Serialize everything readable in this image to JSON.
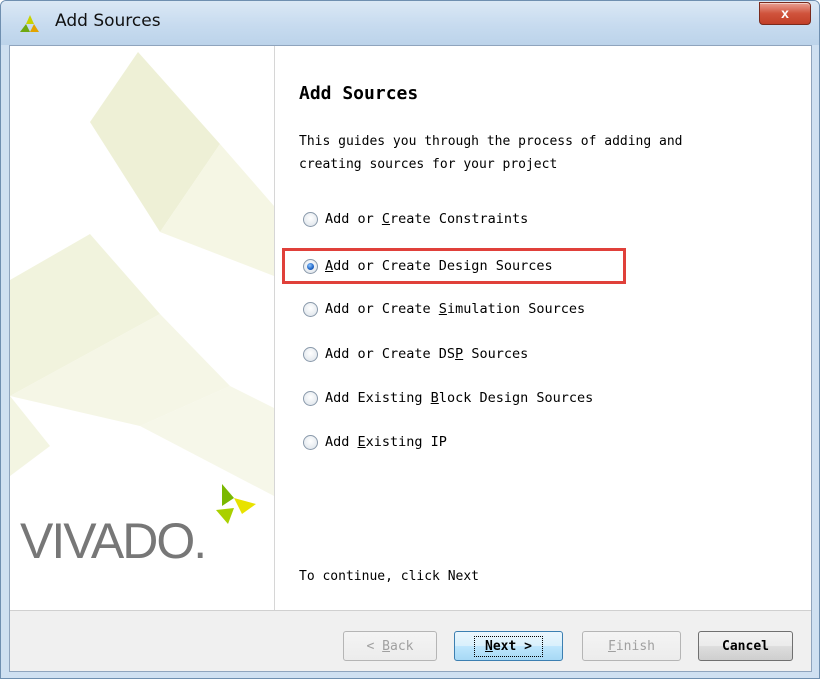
{
  "window": {
    "title": "Add Sources",
    "close_label": "x"
  },
  "logo": {
    "text": "VIVADO",
    "dot": "."
  },
  "main": {
    "heading": "Add Sources",
    "description_line1": "This guides you through the process of adding and",
    "description_line2": "creating sources for your project",
    "options": [
      {
        "pre": "Add or ",
        "mn": "C",
        "post": "reate Constraints",
        "checked": false
      },
      {
        "pre": "",
        "mn": "A",
        "post": "dd or Create Design Sources",
        "checked": true
      },
      {
        "pre": "Add or Create ",
        "mn": "S",
        "post": "imulation Sources",
        "checked": false
      },
      {
        "pre": "Add or Create DS",
        "mn": "P",
        "post": " Sources",
        "checked": false
      },
      {
        "pre": "Add Existing ",
        "mn": "B",
        "post": "lock Design Sources",
        "checked": false
      },
      {
        "pre": "Add ",
        "mn": "E",
        "post": "xisting IP",
        "checked": false
      }
    ],
    "footer": "To continue, click Next"
  },
  "buttons": {
    "back": {
      "pre": "< ",
      "mn": "B",
      "post": "ack"
    },
    "next": {
      "pre": "",
      "mn": "N",
      "post": "ext >"
    },
    "finish": {
      "pre": "",
      "mn": "F",
      "post": "inish"
    },
    "cancel": {
      "label": "Cancel"
    }
  },
  "colors": {
    "highlight": "#e0403a",
    "logo_green": "#7ab800",
    "logo_yellow": "#e8e200",
    "art_light": "#f2f4dc"
  }
}
